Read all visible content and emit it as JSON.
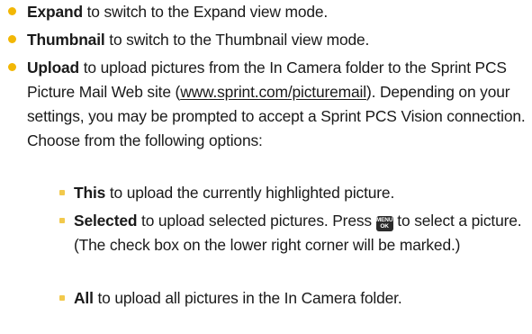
{
  "colors": {
    "bullet": "#f2b705",
    "subbullet": "#f2c94c",
    "text": "#1a1a1a"
  },
  "items": [
    {
      "term": "Expand",
      "text": " to switch to the Expand view mode."
    },
    {
      "term": "Thumbnail",
      "text": " to switch to the Thumbnail view mode."
    },
    {
      "term": "Upload",
      "text_before": " to upload pictures from the In Camera folder to the Sprint PCS Picture Mail Web site (",
      "link": "www.sprint.com/picturemail",
      "text_after": "). Depending on your settings, you may be prompted to accept a Sprint PCS Vision connection. Choose from the following options:"
    }
  ],
  "subitems": [
    {
      "term": "This",
      "text": " to upload the currently highlighted picture."
    },
    {
      "term": "Selected",
      "text_before": " to upload selected pictures. Press ",
      "key_icon": "menu-ok-key-icon",
      "key_top": "MENU",
      "key_bottom": "OK",
      "text_after": " to select a picture. (The check box on the lower right corner will be marked.)"
    },
    {
      "term": "All",
      "text": " to upload all pictures in the In Camera folder."
    }
  ]
}
